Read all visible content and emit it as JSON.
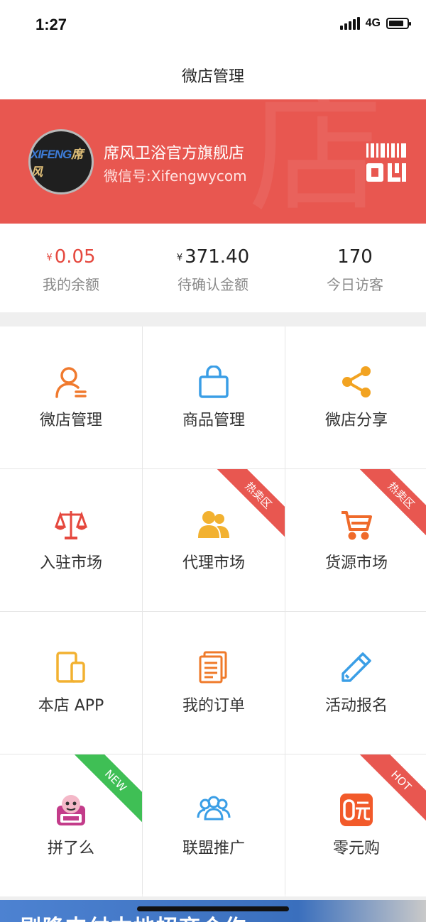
{
  "status_bar": {
    "time": "1:27",
    "network": "4G",
    "battery_level": 0.85
  },
  "nav": {
    "title": "微店管理"
  },
  "shop": {
    "name": "席风卫浴官方旗舰店",
    "wechat_id": "微信号:Xifengwycom",
    "logo_text_main": "XIFENG",
    "logo_text_cn": "席风",
    "watermark": "店",
    "header_color": "#e85750"
  },
  "stats": [
    {
      "currency": "¥",
      "value": "0.05",
      "label": "我的余额"
    },
    {
      "currency": "¥",
      "value": "371.40",
      "label": "待确认金额"
    },
    {
      "currency": "",
      "value": "170",
      "label": "今日访客"
    }
  ],
  "menu": [
    {
      "label": "微店管理",
      "icon": "user-manage-icon",
      "color": "#f07a2e"
    },
    {
      "label": "商品管理",
      "icon": "shopping-bag-icon",
      "color": "#3a9ee6"
    },
    {
      "label": "微店分享",
      "icon": "share-icon",
      "color": "#f2a321"
    },
    {
      "label": "入驻市场",
      "icon": "scale-icon",
      "color": "#e5483e"
    },
    {
      "label": "代理市场",
      "icon": "agents-icon",
      "color": "#f2b130",
      "ribbon": "热卖区",
      "ribbon_color": "#e85750"
    },
    {
      "label": "货源市场",
      "icon": "cart-icon",
      "color": "#ef6a2a",
      "ribbon": "热卖区",
      "ribbon_color": "#e85750"
    },
    {
      "label": "本店 APP",
      "icon": "devices-icon",
      "color": "#f2b130"
    },
    {
      "label": "我的订单",
      "icon": "order-list-icon",
      "color": "#ef7a2a"
    },
    {
      "label": "活动报名",
      "icon": "pencil-icon",
      "color": "#3a9ee6"
    },
    {
      "label": "拼了么",
      "icon": "pinlema-logo-icon",
      "color": "#c33c8a",
      "ribbon": "NEW",
      "ribbon_color": "#3fbf55"
    },
    {
      "label": "联盟推广",
      "icon": "alliance-icon",
      "color": "#3a9ee6"
    },
    {
      "label": "零元购",
      "icon": "zero-buy-icon",
      "color": "#f25a2a",
      "ribbon": "HOT",
      "ribbon_color": "#e85750"
    }
  ],
  "banner": {
    "text": "剧降支付本地招商合作"
  }
}
